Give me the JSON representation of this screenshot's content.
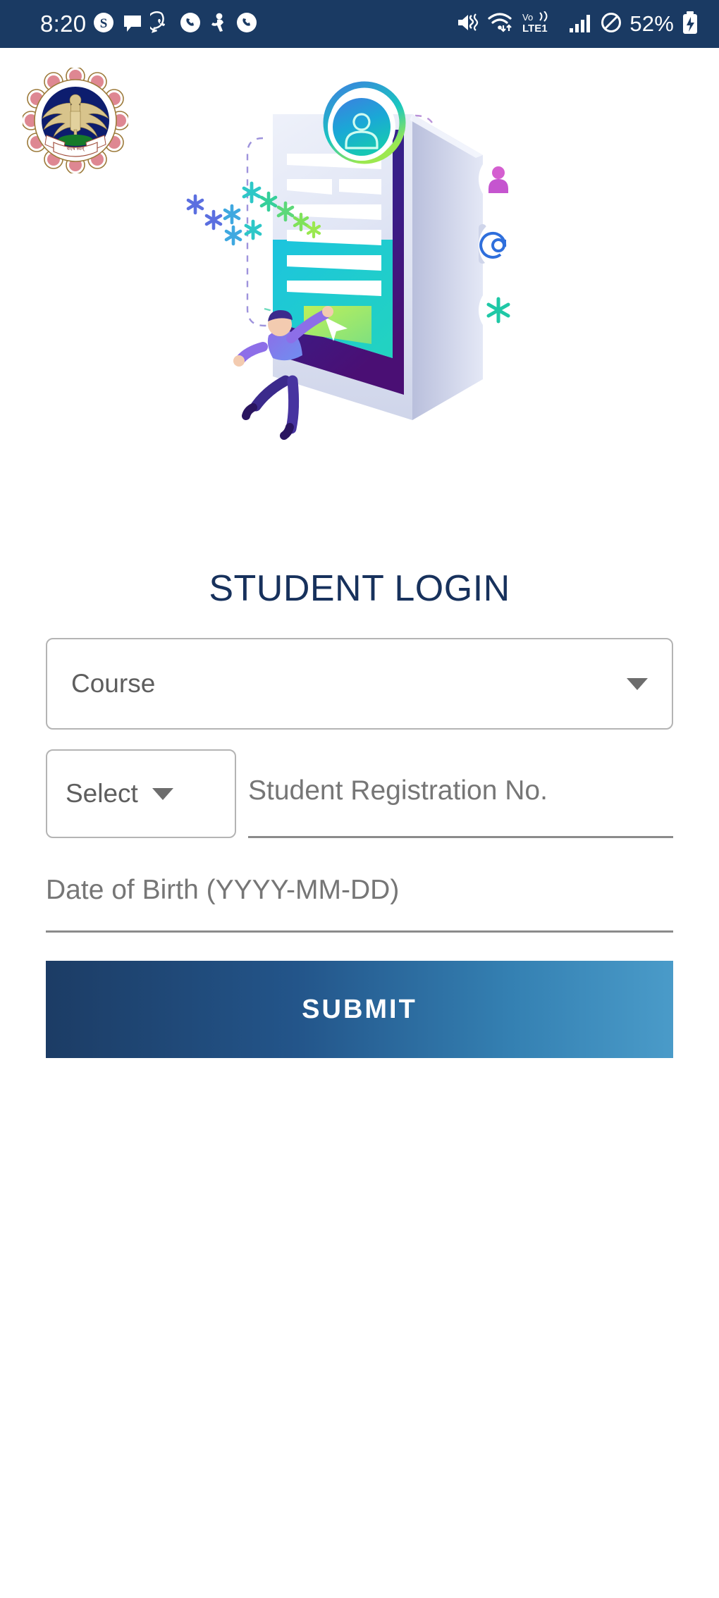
{
  "status_bar": {
    "time": "8:20",
    "battery_percent": "52%",
    "network_label": "VoLTE1",
    "background_color": "#1a3a63",
    "left_icons": [
      "skype-icon",
      "message-bubble-icon",
      "whatsapp-icon",
      "phone-call-icon",
      "person-running-icon",
      "phone-call-icon-2"
    ],
    "right_icons": [
      "mute-vibrate-icon",
      "wifi-icon",
      "volte-icon",
      "signal-bars-icon",
      "do-not-disturb-icon",
      "battery-charging-icon"
    ]
  },
  "header": {
    "logo_name": "icai-emblem-logo",
    "illustration_name": "login-isometric-illustration",
    "gradient_from": "#1f4a78",
    "gradient_to": "#3f8cba",
    "illustration_badges": [
      "person-badge-icon",
      "at-sign-badge-icon",
      "asterisk-badge-icon"
    ]
  },
  "main": {
    "title": "STUDENT LOGIN",
    "title_color": "#17315c",
    "course_select": {
      "value": "Course",
      "caret": "chevron-down-icon"
    },
    "prefix_select": {
      "value": "Select",
      "caret": "chevron-down-icon"
    },
    "registration_input": {
      "value": "",
      "placeholder": "Student Registration No."
    },
    "dob_input": {
      "value": "",
      "placeholder": "Date of Birth (YYYY-MM-DD)"
    },
    "submit_label": "SUBMIT",
    "submit_gradient_from": "#1c3c65",
    "submit_gradient_to": "#4a9bc9"
  }
}
